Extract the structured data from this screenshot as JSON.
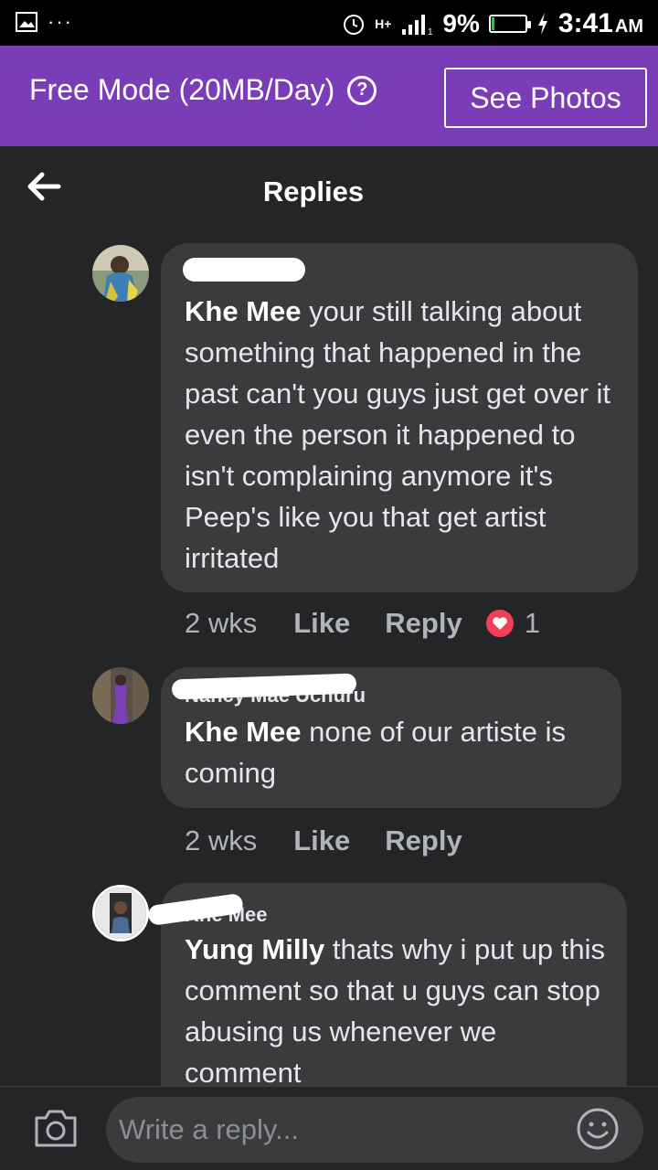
{
  "status_bar": {
    "network": "H+",
    "battery_percent": "9%",
    "time": "3:41",
    "ampm": "AM",
    "battery_level": 0.09
  },
  "banner": {
    "free_mode_label": "Free Mode (20MB/Day)",
    "help_symbol": "?",
    "see_photos_label": "See Photos",
    "background_color": "#7b3cb8"
  },
  "header": {
    "title": "Replies"
  },
  "comments": [
    {
      "author": "",
      "mention": "Khe Mee",
      "text": " your still talking about something that happened in the past can't you guys just get over it even the person it happened to isn't complaining anymore it's Peep's like you that get artist irritated",
      "time": "2 wks",
      "like_label": "Like",
      "reply_label": "Reply",
      "reaction_count": "1"
    },
    {
      "author": "Nancy Mae Uchuru",
      "mention": "Khe Mee",
      "text": " none of our artiste is coming",
      "time": "2 wks",
      "like_label": "Like",
      "reply_label": "Reply"
    },
    {
      "author": "Khe Mee",
      "mention": "Yung Milly",
      "text": " thats why i put up this comment so that u guys can stop abusing us whenever we comment"
    }
  ],
  "composer": {
    "placeholder": "Write a reply..."
  },
  "icons": {
    "back": "back-arrow-icon",
    "camera": "camera-icon",
    "emoji": "emoji-icon",
    "reaction": "heart-icon"
  },
  "colors": {
    "accent": "#7b3cb8",
    "reaction": "#f33e58",
    "background": "#242526",
    "bubble": "#3a3b3c"
  }
}
